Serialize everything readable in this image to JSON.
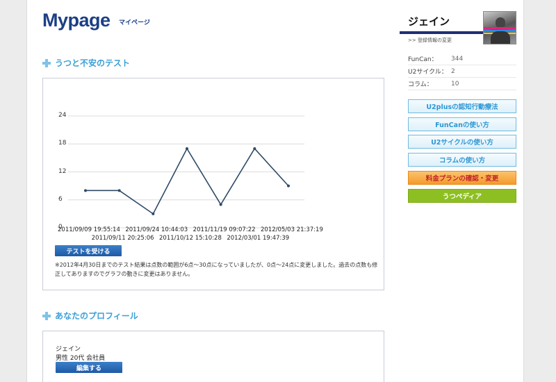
{
  "header": {
    "logo": "Mypage",
    "logo_sub": "マイページ"
  },
  "test_section": {
    "title": "うつと不安のテスト",
    "button_label": "テストを受ける",
    "note": "※2012年4月30日までのテスト結果は点数の範囲が6点〜30点になっていましたが、0点〜24点に変更しました。過去の点数も修正してありますのでグラフの動きに変更はありません。"
  },
  "chart_data": {
    "type": "line",
    "x": [
      "2011/09/09 19:55:14",
      "2011/09/11 20:25:06",
      "2011/09/24 10:44:03",
      "2011/10/12 15:10:28",
      "2011/11/19 09:07:22",
      "2012/03/01 19:47:39",
      "2012/05/03 21:37:19"
    ],
    "values": [
      8,
      8,
      3,
      17,
      5,
      17,
      9
    ],
    "yticks": [
      "0",
      "6",
      "12",
      "18",
      "24"
    ],
    "ylim": [
      0,
      24
    ],
    "grid": true,
    "line_color": "#2e4a66"
  },
  "profile_section": {
    "title": "あなたのプロフィール",
    "name": "ジェイン",
    "info": "男性 20代 会社員",
    "edit_label": "編集する"
  },
  "sidebar": {
    "user_name": "ジェイン",
    "edit_link": ">> 登録情報の変更",
    "stats": [
      {
        "label": "FunCan：",
        "value": "344"
      },
      {
        "label": "U2サイクル：",
        "value": "2"
      },
      {
        "label": "コラム：",
        "value": "10"
      }
    ],
    "links": [
      {
        "label": "U2plusの認知行動療法"
      },
      {
        "label": "FunCanの使い方"
      },
      {
        "label": "U2サイクルの使い方"
      },
      {
        "label": "コラムの使い方"
      },
      {
        "label": "料金プランの確認・変更"
      },
      {
        "label": "うつペディア"
      }
    ]
  }
}
